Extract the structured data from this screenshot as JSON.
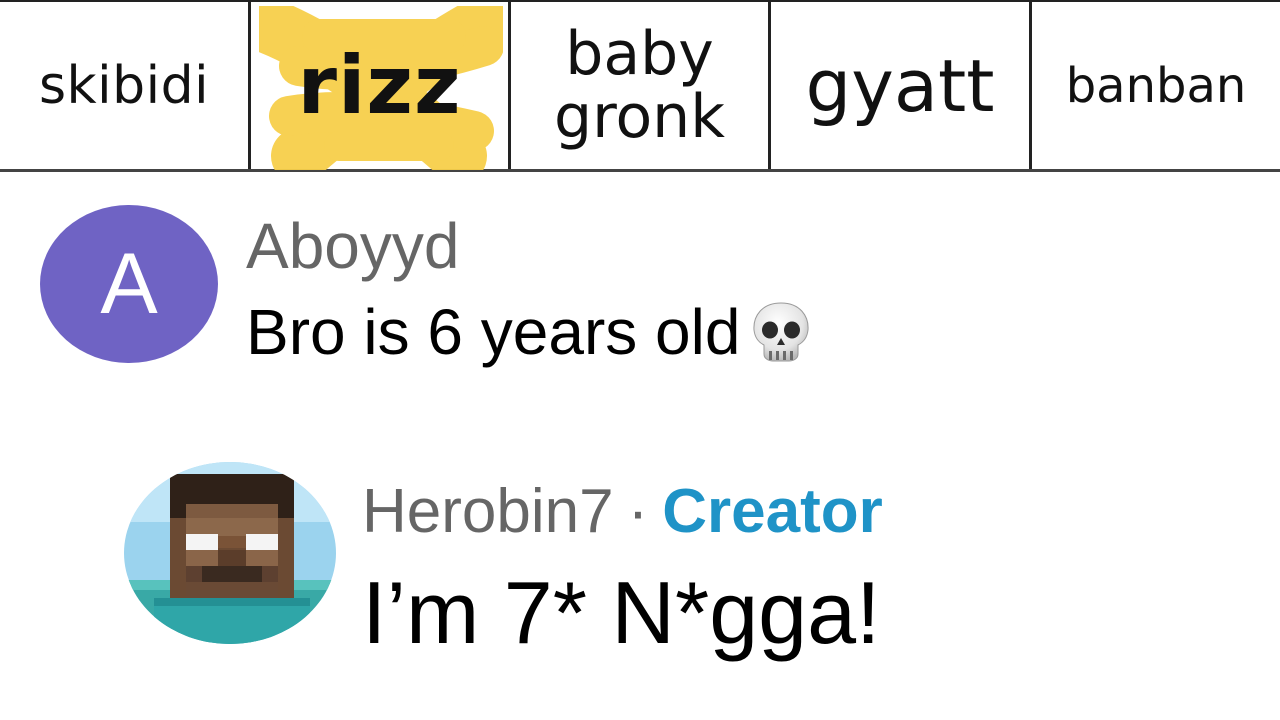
{
  "tabs": [
    {
      "label": "skibidi"
    },
    {
      "label": "rizz",
      "crossed_out": true,
      "highlight_color": "#f7cf4a"
    },
    {
      "label_line1": "baby",
      "label_line2": "gronk"
    },
    {
      "label": "gyatt"
    },
    {
      "label": "banban"
    }
  ],
  "comments": [
    {
      "avatar_letter": "A",
      "avatar_color": "#6f63c4",
      "author": "Aboyyd",
      "text": "Bro is 6 years old",
      "emoji": "skull-icon"
    },
    {
      "avatar": "herobrine-avatar-icon",
      "author": "Herobin7",
      "separator": "·",
      "badge": "Creator",
      "badge_color": "#1f93c7",
      "text": "I’m 7* N*gga!"
    }
  ]
}
